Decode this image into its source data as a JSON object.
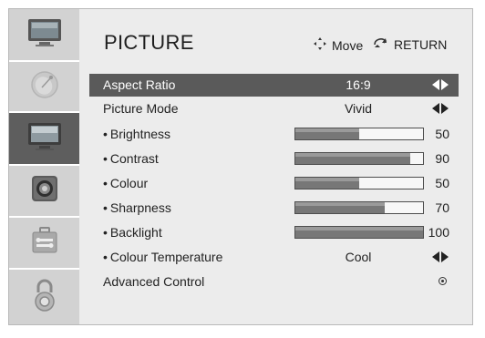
{
  "menu": {
    "title": "PICTURE",
    "hints": {
      "move_label": "Move",
      "return_label": "RETURN"
    }
  },
  "sidebar": {
    "items": [
      {
        "icon": "tv-top-icon",
        "active": false
      },
      {
        "icon": "satellite-dish-icon",
        "active": false
      },
      {
        "icon": "tv-picture-icon",
        "active": true
      },
      {
        "icon": "speaker-icon",
        "active": false
      },
      {
        "icon": "toolbox-icon",
        "active": false
      },
      {
        "icon": "padlock-icon",
        "active": false
      }
    ]
  },
  "settings": [
    {
      "label": "Aspect Ratio",
      "value": "16:9",
      "control": "arrows",
      "selected": true
    },
    {
      "label": "Picture Mode",
      "value": "Vivid",
      "control": "arrows"
    },
    {
      "label": "Brightness",
      "bullet": true,
      "level": 50,
      "max": 100
    },
    {
      "label": "Contrast",
      "bullet": true,
      "level": 90,
      "max": 100
    },
    {
      "label": "Colour",
      "bullet": true,
      "level": 50,
      "max": 100
    },
    {
      "label": "Sharpness",
      "bullet": true,
      "level": 70,
      "max": 100
    },
    {
      "label": "Backlight",
      "bullet": true,
      "level": 100,
      "max": 100
    },
    {
      "label": "Colour Temperature",
      "bullet": true,
      "value": "Cool",
      "control": "arrows"
    },
    {
      "label": "Advanced Control",
      "control": "radio"
    }
  ],
  "colors": {
    "selected_row": "#5a5a5a",
    "sidebar": "#d2d2d2",
    "background": "#ececec"
  }
}
